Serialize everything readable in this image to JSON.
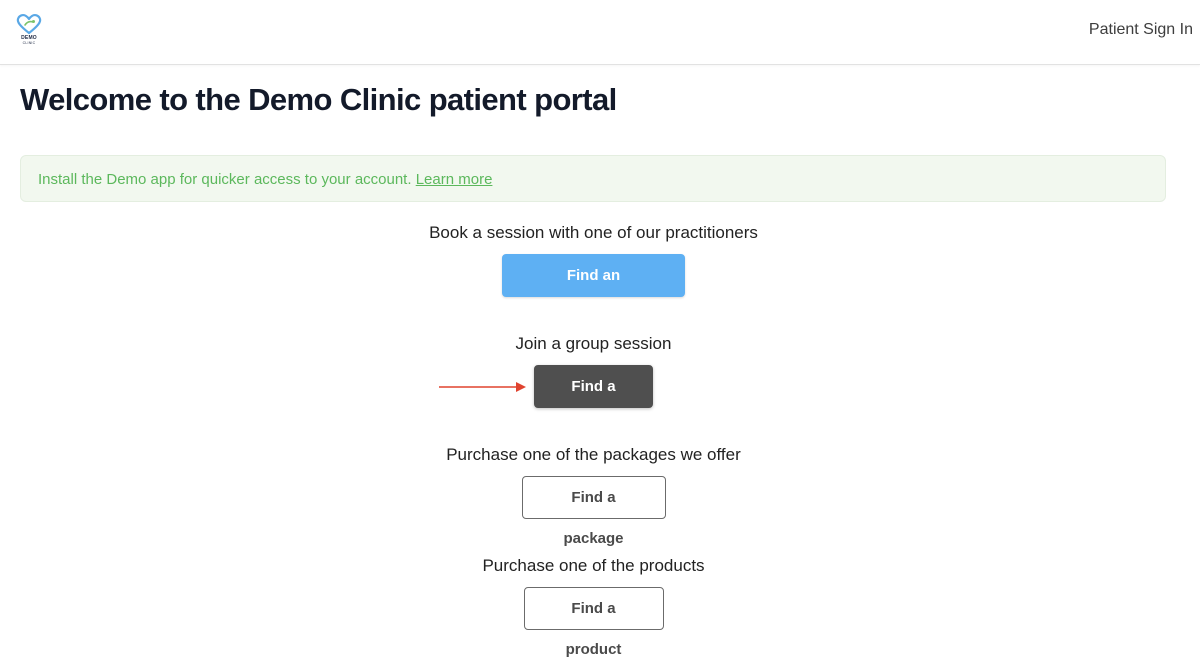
{
  "header": {
    "logo": {
      "line1": "DEMO",
      "line2": "CLINIC"
    },
    "sign_in": "Patient Sign In"
  },
  "main": {
    "title": "Welcome to the Demo Clinic patient portal",
    "banner": {
      "text": "Install the Demo app for quicker access to your account. ",
      "link": "Learn more"
    },
    "sections": [
      {
        "label": "Book a session with one of our practitioners",
        "button": "Find an appointment"
      },
      {
        "label": "Join a group session",
        "button": "Find a class"
      },
      {
        "label": "Purchase one of the packages we offer",
        "button": "Find a package"
      },
      {
        "label": "Purchase one of the products",
        "button": "Find a product"
      }
    ]
  },
  "colors": {
    "primary": "#5eb0f3",
    "dark_button": "#4f4f4f",
    "banner_bg": "#f2f8ef",
    "banner_text": "#5cb85c",
    "annotation_arrow": "#e0432f"
  }
}
